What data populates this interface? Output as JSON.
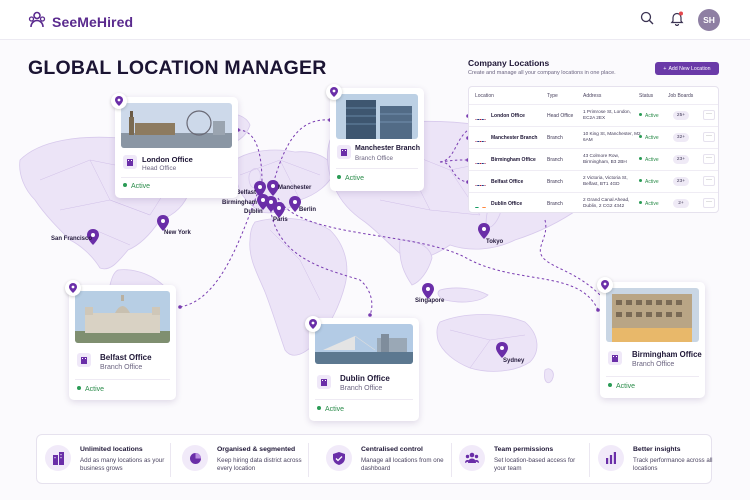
{
  "app": {
    "name": "SeeMeHired",
    "avatar_initials": "SH",
    "accent": "#5a2a8e",
    "button_color": "#6a3aa8",
    "status_color": "#2a9b55"
  },
  "header": {
    "icons": [
      "people-logo-icon",
      "search-icon",
      "bell-icon"
    ]
  },
  "page": {
    "title": "GLOBAL LOCATION MANAGER"
  },
  "map": {
    "cities": [
      "San Francisco",
      "New York",
      "Belfast",
      "Birmingham",
      "Dublin",
      "Manchester",
      "Paris",
      "Berlin",
      "Tokyo",
      "Singapore",
      "Sydney"
    ]
  },
  "cards": {
    "london": {
      "name": "London Office",
      "type": "Head Office",
      "status": "Active"
    },
    "manchester": {
      "name": "Manchester Branch",
      "type": "Branch Office",
      "status": "Active"
    },
    "belfast": {
      "name": "Belfast Office",
      "type": "Branch Office",
      "status": "Active"
    },
    "dublin": {
      "name": "Dublin Office",
      "type": "Branch Office",
      "status": "Active"
    },
    "birmingham": {
      "name": "Birmingham Office",
      "type": "Branch Office",
      "status": "Active"
    }
  },
  "panel": {
    "title": "Company Locations",
    "subtitle": "Create and manage all your company locations in one place.",
    "add_button": "Add New Location",
    "columns": [
      "Location",
      "Type",
      "Address",
      "Status",
      "Job Boards"
    ],
    "rows": [
      {
        "flag": "uk",
        "location": "London Office",
        "type": "Head Office",
        "address": "1 Primrose St, London, EC2A 2EX",
        "status": "Active",
        "job_boards": "25+"
      },
      {
        "flag": "uk",
        "location": "Manchester Branch",
        "type": "Branch",
        "address": "10 King St, Manchester, M2 6AM",
        "status": "Active",
        "job_boards": "32+"
      },
      {
        "flag": "uk",
        "location": "Birmingham Office",
        "type": "Branch",
        "address": "43 Colmore Row, Birmingham, B3 2BH",
        "status": "Active",
        "job_boards": "23+"
      },
      {
        "flag": "uk",
        "location": "Belfast Office",
        "type": "Branch",
        "address": "2 Victoria, Victoria St, Belfast, BT1 4GD",
        "status": "Active",
        "job_boards": "23+"
      },
      {
        "flag": "ie",
        "location": "Dublin Office",
        "type": "Branch",
        "address": "2 Grand Canal Ahead, Dublin, 2 CG2 4342",
        "status": "Active",
        "job_boards": "2+"
      }
    ]
  },
  "features": [
    {
      "icon": "buildings-icon",
      "title": "Unlimited locations",
      "desc": "Add as many locations as your business grows"
    },
    {
      "icon": "pie-chart-icon",
      "title": "Organised & segmented",
      "desc": "Keep hiring data district across every location"
    },
    {
      "icon": "shield-check-icon",
      "title": "Centralised control",
      "desc": "Manage all locations from one dashboard"
    },
    {
      "icon": "team-icon",
      "title": "Team permissions",
      "desc": "Set location-based access for your team"
    },
    {
      "icon": "bar-chart-icon",
      "title": "Better insights",
      "desc": "Track performance across all locations"
    }
  ]
}
